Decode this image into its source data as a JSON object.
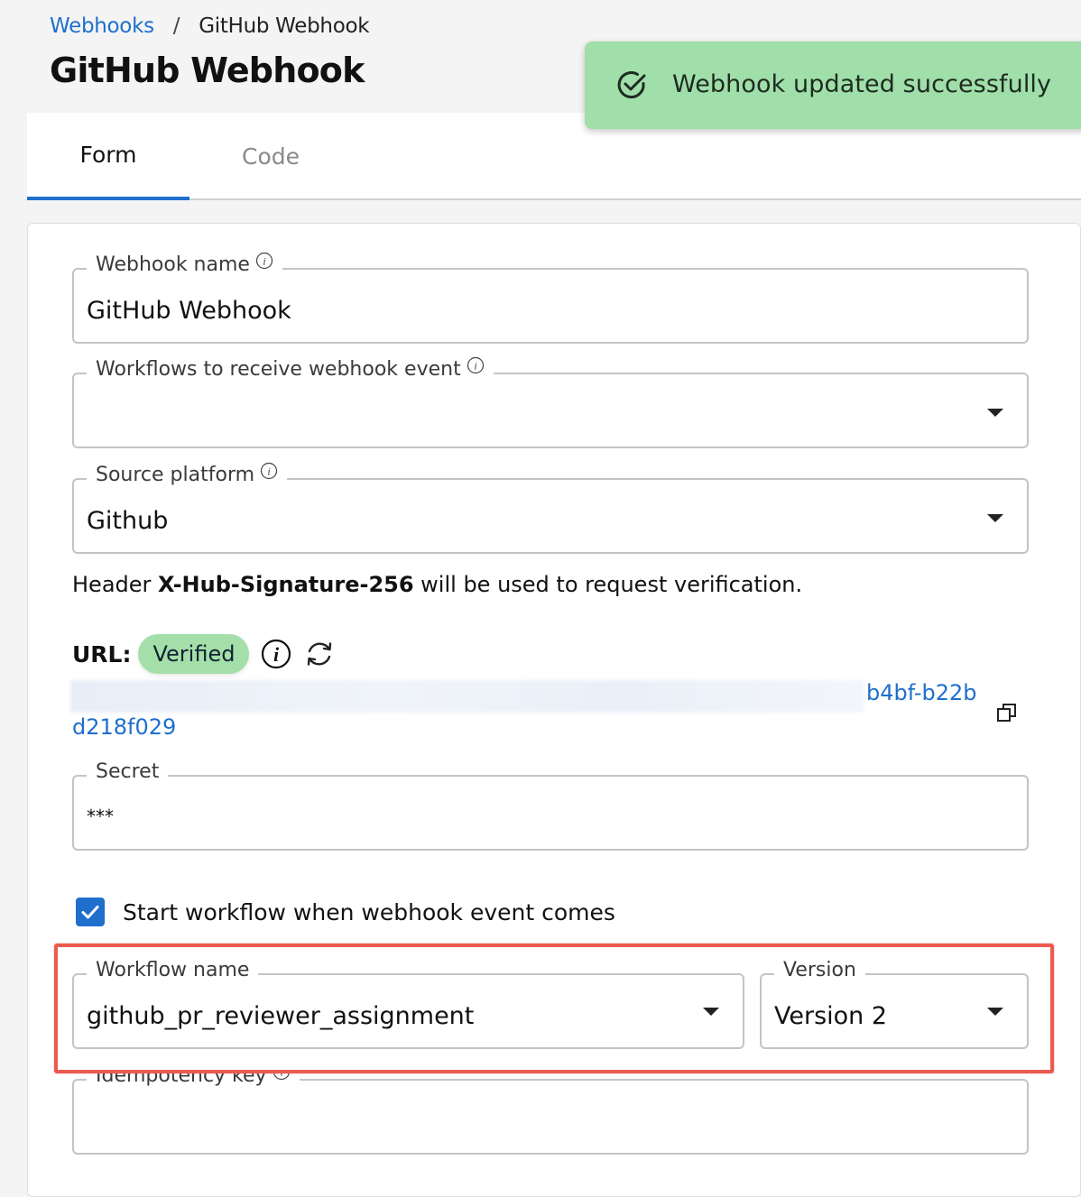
{
  "breadcrumb": {
    "parent": "Webhooks",
    "separator": "/",
    "current": "GitHub Webhook"
  },
  "page": {
    "title": "GitHub Webhook"
  },
  "toast": {
    "message": "Webhook updated successfully"
  },
  "tabs": [
    {
      "label": "Form"
    },
    {
      "label": "Code"
    }
  ],
  "form": {
    "webhook_name": {
      "label": "Webhook name",
      "value": "GitHub Webhook"
    },
    "workflows": {
      "label": "Workflows to receive webhook event",
      "value": ""
    },
    "source_platform": {
      "label": "Source platform",
      "value": "Github"
    },
    "hint": {
      "prefix": "Header ",
      "header": "X-Hub-Signature-256",
      "suffix": " will be used to request verification."
    },
    "url": {
      "label": "URL:",
      "status": "Verified",
      "tail": "b4bf-b22b",
      "line2": "d218f029"
    },
    "secret": {
      "label": "Secret",
      "value": "***"
    },
    "start_workflow": {
      "label": "Start workflow when webhook event comes",
      "checked": true
    },
    "workflow_name": {
      "label": "Workflow name",
      "value": "github_pr_reviewer_assignment"
    },
    "version": {
      "label": "Version",
      "value": "Version 2"
    },
    "idempotency": {
      "label": "Idempotency key",
      "value": ""
    }
  },
  "colors": {
    "accent": "#1f6fcc",
    "toast_bg": "#a0dfa9",
    "badge_bg": "#a4dfa9",
    "highlight": "#ec5b50"
  },
  "icons": {
    "toast": "check-circle-icon",
    "info": "info-icon",
    "refresh": "refresh-icon",
    "copy": "copy-icon",
    "dropdown": "caret-down-icon",
    "checkbox": "checkmark-icon"
  }
}
